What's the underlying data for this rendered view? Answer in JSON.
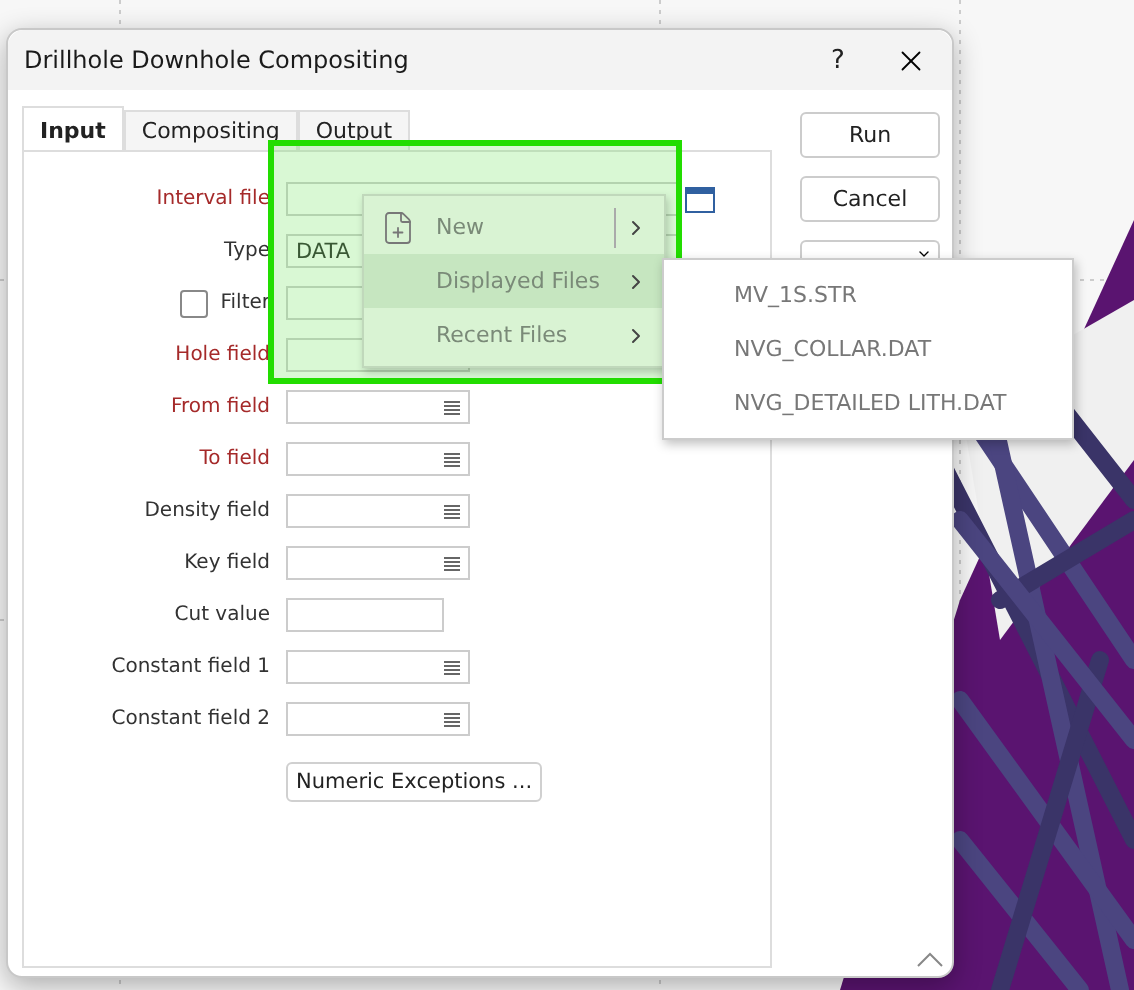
{
  "window": {
    "title": "Drillhole Downhole Compositing",
    "help": "?"
  },
  "tabs": [
    {
      "label": "Input",
      "selected": true
    },
    {
      "label": "Compositing",
      "selected": false
    },
    {
      "label": "Output",
      "selected": false
    }
  ],
  "fields": [
    {
      "kind": "file",
      "label": "Interval file",
      "required": true
    },
    {
      "kind": "combo",
      "label": "Type",
      "required": false,
      "value": "DATA"
    },
    {
      "kind": "check",
      "label": "Filter",
      "required": false,
      "checked": false
    },
    {
      "kind": "plain",
      "label": "Hole field",
      "required": true
    },
    {
      "kind": "list",
      "label": "From field",
      "required": true
    },
    {
      "kind": "list",
      "label": "To field",
      "required": true
    },
    {
      "kind": "list",
      "label": "Density field",
      "required": false
    },
    {
      "kind": "list",
      "label": "Key field",
      "required": false
    },
    {
      "kind": "text",
      "label": "Cut value",
      "required": false
    },
    {
      "kind": "list",
      "label": "Constant field 1",
      "required": false
    },
    {
      "kind": "list",
      "label": "Constant field 2",
      "required": false
    }
  ],
  "numeric_exceptions_button": "Numeric Exceptions ...",
  "buttons": [
    "Run",
    "Cancel"
  ],
  "context_menu": [
    {
      "label": "New",
      "selected": false,
      "kind": "split"
    },
    {
      "label": "Displayed Files",
      "selected": true,
      "kind": "submenu"
    },
    {
      "label": "Recent Files",
      "selected": false,
      "kind": "submenu"
    }
  ],
  "submenu": [
    "MV_1S.STR",
    "NVG_COLLAR.DAT",
    "NVG_DETAILED LITH.DAT"
  ]
}
